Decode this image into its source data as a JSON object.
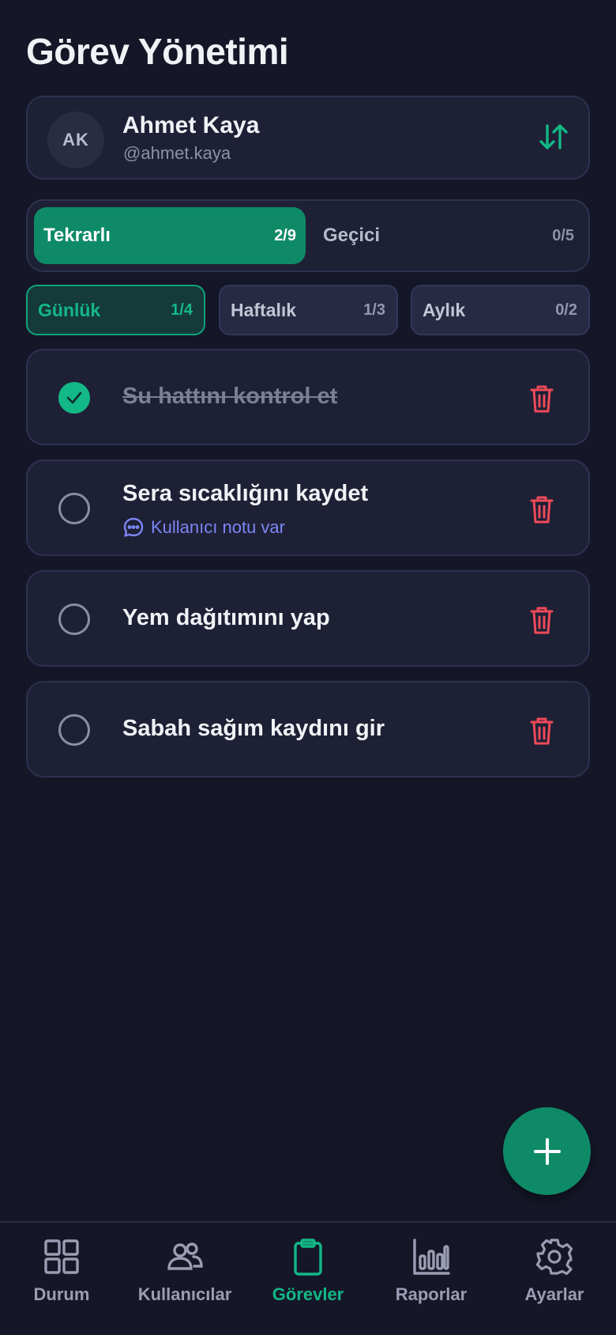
{
  "header": {
    "title": "Görev Yönetimi"
  },
  "user": {
    "initials": "AK",
    "name": "Ahmet Kaya",
    "handle": "@ahmet.kaya",
    "swap_icon": "sort-arrows-icon"
  },
  "segments": [
    {
      "label": "Tekrarlı",
      "count": "2/9",
      "active": true
    },
    {
      "label": "Geçici",
      "count": "0/5",
      "active": false
    }
  ],
  "periods": [
    {
      "label": "Günlük",
      "count": "1/4",
      "active": true
    },
    {
      "label": "Haftalık",
      "count": "1/3",
      "active": false
    },
    {
      "label": "Aylık",
      "count": "0/2",
      "active": false
    }
  ],
  "tasks": [
    {
      "title": "Su hattını kontrol et",
      "done": true,
      "note": null
    },
    {
      "title": "Sera sıcaklığını kaydet",
      "done": false,
      "note": "Kullanıcı notu var"
    },
    {
      "title": "Yem dağıtımını yap",
      "done": false,
      "note": null
    },
    {
      "title": "Sabah sağım kaydını gir",
      "done": false,
      "note": null
    }
  ],
  "fab": {
    "icon": "plus-icon"
  },
  "nav": [
    {
      "label": "Durum",
      "icon": "grid-icon",
      "active": false
    },
    {
      "label": "Kullanıcılar",
      "icon": "users-icon",
      "active": false
    },
    {
      "label": "Görevler",
      "icon": "clipboard-icon",
      "active": true
    },
    {
      "label": "Raporlar",
      "icon": "bar-chart-icon",
      "active": false
    },
    {
      "label": "Ayarlar",
      "icon": "gear-icon",
      "active": false
    }
  ],
  "colors": {
    "background": "#151728",
    "card": "#1e2035",
    "accent": "#0e8a67",
    "accent_text": "#12b886",
    "danger": "#ef4a5a",
    "link": "#7b86f3"
  }
}
